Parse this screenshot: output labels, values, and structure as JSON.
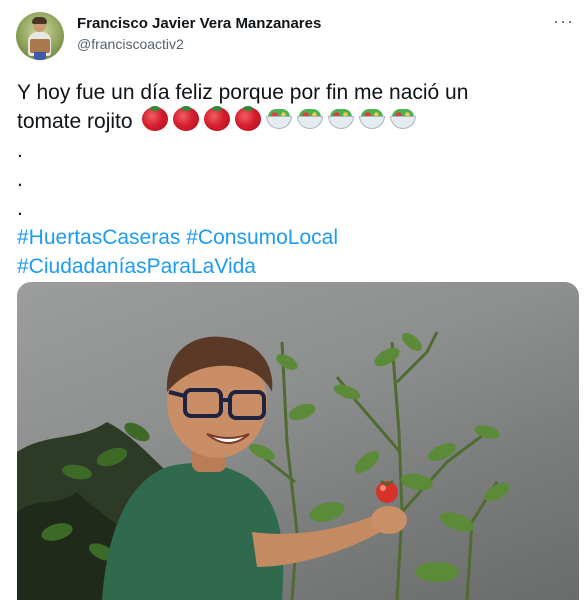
{
  "user": {
    "display_name": "Francisco Javier Vera Manzanares",
    "handle": "@franciscoactiv2"
  },
  "menu": {
    "more_label": "···"
  },
  "tweet": {
    "line1": "Y hoy fue un día feliz porque por fin me nació un",
    "line2_text": "tomate rojito",
    "dots": [
      ".",
      ".",
      "."
    ],
    "hashtags_line1": [
      "#HuertasCaseras",
      "#ConsumoLocal"
    ],
    "hashtags_line2": [
      "#CiudadaníasParaLaVida"
    ],
    "emojis": [
      "tomato-emoji",
      "tomato-emoji",
      "tomato-emoji",
      "tomato-emoji",
      "salad-emoji",
      "salad-emoji",
      "salad-emoji",
      "salad-emoji",
      "salad-emoji"
    ]
  },
  "colors": {
    "link": "#1d9bf0",
    "text": "#0f1419",
    "secondary": "#536471"
  }
}
